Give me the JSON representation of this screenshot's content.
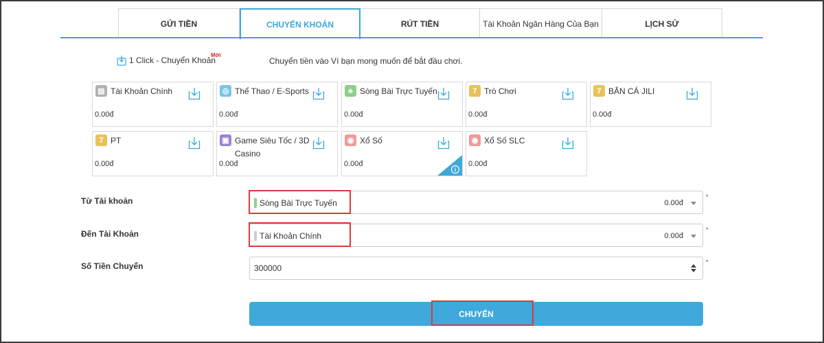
{
  "tabs": [
    {
      "label": "GỬI TIỀN"
    },
    {
      "label": "CHUYỂN KHOẢN"
    },
    {
      "label": "RÚT TIỀN"
    },
    {
      "label": "Tài Khoản Ngân Hàng Của Bạn"
    },
    {
      "label": "LỊCH SỬ"
    }
  ],
  "one_click": {
    "label": "1 Click - Chuyển Khoản",
    "badge": "Mới"
  },
  "intro": "Chuyển tiền vào Ví bạn mong muốn để bắt đầu chơi.",
  "wallets": [
    {
      "name": "Tài Khoản Chính",
      "balance": "0.00đ",
      "icon": "main-account-icon",
      "color": "#b0b0b0"
    },
    {
      "name": "Thể Thao / E-Sports",
      "balance": "0.00đ",
      "icon": "sports-icon",
      "color": "#7cc3e8"
    },
    {
      "name": "Sòng Bài Trực Tuyến",
      "balance": "0.00đ",
      "icon": "casino-icon",
      "color": "#8fcf8a"
    },
    {
      "name": "Trò Chơi",
      "balance": "0.00đ",
      "icon": "games-icon",
      "color": "#e8c25a"
    },
    {
      "name": "BẮN CÁ JILI",
      "balance": "0.00đ",
      "icon": "fishing-icon",
      "color": "#e8c25a"
    },
    {
      "name": "PT",
      "balance": "0.00đ",
      "icon": "pt-icon",
      "color": "#e8c25a"
    },
    {
      "name": "Game Siêu Tốc / 3D Casino",
      "balance": "0.00đ",
      "icon": "fast-game-icon",
      "color": "#9b84d6"
    },
    {
      "name": "Xổ Số",
      "balance": "0.00đ",
      "icon": "lottery-icon",
      "color": "#f09a9a"
    },
    {
      "name": "Xổ Số SLC",
      "balance": "0.00đ",
      "icon": "lottery-slc-icon",
      "color": "#f09a9a"
    }
  ],
  "form": {
    "from_label": "Từ Tài khoản",
    "from_value": "Sòng Bài Trực Tuyến",
    "from_balance": "0.00đ",
    "from_color": "#8fcf8a",
    "to_label": "Đến Tài Khoản",
    "to_value": "Tài Khoản Chính",
    "to_balance": "0.00đ",
    "to_color": "#cccccc",
    "amount_label": "Số Tiền Chuyển",
    "amount_value": "300000",
    "required_mark": "*"
  },
  "submit_label": "CHUYỂN",
  "colors": {
    "accent": "#39a9d7",
    "highlight": "#d93a3a"
  }
}
